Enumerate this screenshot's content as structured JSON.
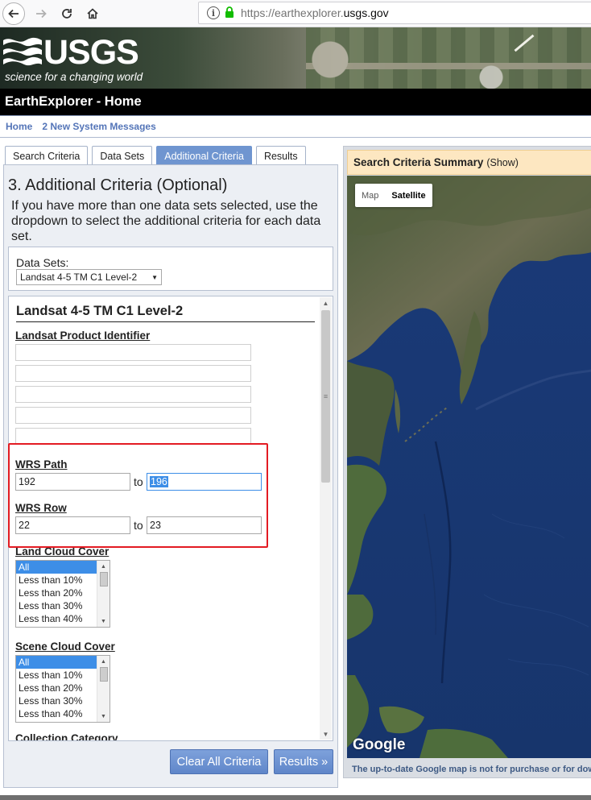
{
  "browser": {
    "url_prefix": "https://earthexplorer.",
    "url_domain": "usgs.gov"
  },
  "header": {
    "logo_text": "USGS",
    "tagline": "science for a changing world",
    "page_title": "EarthExplorer - Home"
  },
  "breadcrumb": {
    "home": "Home",
    "messages": "2 New System Messages"
  },
  "tabs": [
    {
      "label": "Search Criteria",
      "active": false
    },
    {
      "label": "Data Sets",
      "active": false
    },
    {
      "label": "Additional Criteria",
      "active": true
    },
    {
      "label": "Results",
      "active": false
    }
  ],
  "step": {
    "title": "3. Additional Criteria (Optional)",
    "description": "If you have more than one data sets selected, use the dropdown to select the additional criteria for each data set."
  },
  "datasets": {
    "label": "Data Sets:",
    "selected": "Landsat 4-5 TM C1 Level-2"
  },
  "criteria": {
    "dataset_heading": "Landsat 4-5 TM C1 Level-2",
    "product_id_label": "Landsat Product Identifier",
    "wrs_path": {
      "label": "WRS Path",
      "from": "192",
      "to_word": "to",
      "to": "196"
    },
    "wrs_row": {
      "label": "WRS Row",
      "from": "22",
      "to_word": "to",
      "to": "23"
    },
    "land_cloud": {
      "label": "Land Cloud Cover",
      "options": [
        "All",
        "Less than 10%",
        "Less than 20%",
        "Less than 30%",
        "Less than 40%"
      ],
      "selected": "All"
    },
    "scene_cloud": {
      "label": "Scene Cloud Cover",
      "options": [
        "All",
        "Less than 10%",
        "Less than 20%",
        "Less than 30%",
        "Less than 40%"
      ],
      "selected": "All"
    },
    "cut_off_label": "Collection Category"
  },
  "buttons": {
    "clear": "Clear All Criteria",
    "results": "Results »"
  },
  "map_panel": {
    "summary_title": "Search Criteria Summary",
    "summary_show": "(Show)",
    "map_btn": "Map",
    "satellite_btn": "Satellite",
    "google": "Google",
    "note": "The up-to-date Google map is not for purchase or for download"
  },
  "colors": {
    "tab_active": "#6f95d0",
    "highlight": "#e31b23",
    "link": "#5475b8",
    "summary_bg": "#fde7c1"
  }
}
